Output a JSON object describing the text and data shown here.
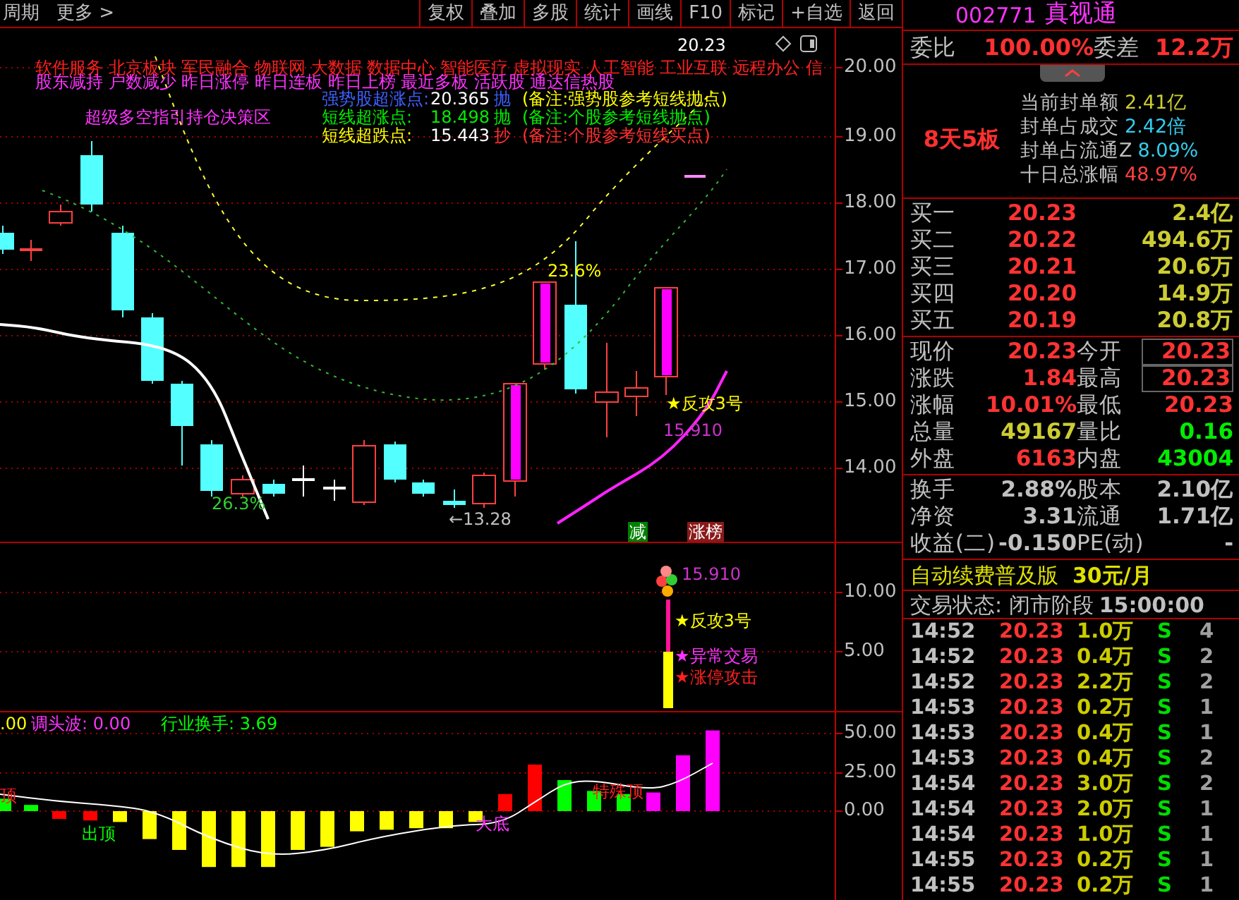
{
  "toolbar": {
    "period_label": "周期",
    "more_label": "更多 >",
    "buttons": [
      "复权",
      "叠加",
      "多股",
      "统计",
      "画线",
      "F10",
      "标记",
      "+自选",
      "返回"
    ]
  },
  "main_chart": {
    "concept_tags": "软件服务 北京板块 军民融合 物联网 大数据 数据中心 智能医疗 虚拟现实 人工智能 工业互联 远程办公 信",
    "signal_tags": "股东减持 户数减少 昨日涨停 昨日连板 昨日上榜 最近多板 活跃股 通达信热股",
    "overlay_price": "20.23",
    "title": "超级多空指引持仓决策区",
    "alerts": [
      {
        "kind": "strong",
        "label": "强势股超涨点:",
        "value": "20.365",
        "action": "抛",
        "note": "(备注:强势股参考短线抛点)"
      },
      {
        "kind": "sell",
        "label": "短线超涨点:",
        "value": "18.498",
        "action": "抛",
        "note": "(备注:个股参考短线抛点)"
      },
      {
        "kind": "buy",
        "label": "短线超跌点:",
        "value": "15.443",
        "action": "抄",
        "note": "(备注:个股参考短线买点)"
      }
    ],
    "annotations": [
      {
        "text": "23.6%",
        "color": "#ffff00"
      },
      {
        "text": "26.3%",
        "color": "#33cc33"
      },
      {
        "text": "←13.28",
        "color": "#c0c0c0"
      },
      {
        "text": "★反攻3号",
        "color": "#ffff00"
      },
      {
        "text": "15.910",
        "color": "#cc33cc"
      }
    ],
    "badges": [
      {
        "text": "减",
        "color": "#008000"
      },
      {
        "text": "涨榜",
        "color": "#8b1a1a"
      }
    ],
    "axis_labels": [
      "20.00",
      "19.00",
      "18.00",
      "17.00",
      "16.00",
      "15.00",
      "14.00"
    ]
  },
  "signal_chart": {
    "annotations": [
      {
        "text": "15.910",
        "color": "#cc33cc"
      },
      {
        "text": "★反攻3号",
        "color": "#ffff00"
      },
      {
        "text": "★异常交易",
        "color": "#ff33ff"
      },
      {
        "text": "★涨停攻击",
        "color": "#ff2020"
      }
    ],
    "axis_labels": [
      "10.00",
      "5.00"
    ]
  },
  "wave_chart": {
    "legend": [
      {
        "text": ".00",
        "color": "#ffff00"
      },
      {
        "text": "调头波: 0.00",
        "color": "#ff33ff"
      },
      {
        "text": "行业换手: 3.69",
        "color": "#00ff00"
      }
    ],
    "annotations": [
      {
        "text": "顶",
        "color": "#ff2020"
      },
      {
        "text": "出顶",
        "color": "#00ff00"
      },
      {
        "text": "大底",
        "color": "#ff33ff"
      },
      {
        "text": "特殊顶",
        "color": "#ff2020"
      }
    ],
    "axis_labels": [
      "50.00",
      "25.00",
      "0.00"
    ]
  },
  "quote_header": {
    "code": "002771",
    "name": "真视通"
  },
  "order_ratio": [
    {
      "label": "委比",
      "value": "100.00%"
    },
    {
      "label": "委差",
      "value": "12.2万"
    }
  ],
  "limit_info": {
    "streak": "8天5板",
    "rows": [
      {
        "label": "当前封单额",
        "value": "2.41亿",
        "color": "#cccc33"
      },
      {
        "label": "封单占成交",
        "value": "2.42倍",
        "color": "#33ccee"
      },
      {
        "label": "封单占流通Z",
        "value": "8.09%",
        "color": "#33ccee"
      },
      {
        "label": "十日总涨幅",
        "value": "48.97%",
        "color": "#ff4040"
      }
    ]
  },
  "bids": [
    {
      "label": "买一",
      "price": "20.23",
      "volume": "2.4亿"
    },
    {
      "label": "买二",
      "price": "20.22",
      "volume": "494.6万"
    },
    {
      "label": "买三",
      "price": "20.21",
      "volume": "20.6万"
    },
    {
      "label": "买四",
      "price": "20.20",
      "volume": "14.9万"
    },
    {
      "label": "买五",
      "price": "20.19",
      "volume": "20.8万"
    }
  ],
  "stats": [
    {
      "label": "现价",
      "value": "20.23",
      "color": "#ff3333",
      "boxed": false
    },
    {
      "label": "今开",
      "value": "20.23",
      "color": "#ff3333",
      "boxed": true
    },
    {
      "label": "涨跌",
      "value": "1.84",
      "color": "#ff3333",
      "boxed": false
    },
    {
      "label": "最高",
      "value": "20.23",
      "color": "#ff3333",
      "boxed": true
    },
    {
      "label": "涨幅",
      "value": "10.01%",
      "color": "#ff3333",
      "boxed": false
    },
    {
      "label": "最低",
      "value": "20.23",
      "color": "#ff3333",
      "boxed": false
    },
    {
      "label": "总量",
      "value": "49167",
      "color": "#cccc33",
      "boxed": false
    },
    {
      "label": "量比",
      "value": "0.16",
      "color": "#00ee00",
      "boxed": false
    },
    {
      "label": "外盘",
      "value": "6163",
      "color": "#ff3333",
      "boxed": false
    },
    {
      "label": "内盘",
      "value": "43004",
      "color": "#00ee00",
      "boxed": false
    }
  ],
  "fundamentals": [
    {
      "label": "换手",
      "value": "2.88%"
    },
    {
      "label": "股本",
      "value": "2.10亿"
    },
    {
      "label": "净资",
      "value": "3.31"
    },
    {
      "label": "流通",
      "value": "1.71亿"
    },
    {
      "label": "收益(二)",
      "value": "-0.150"
    },
    {
      "label": "PE(动)",
      "value": "-"
    }
  ],
  "promo": {
    "text": "自动续费普及版",
    "price": "30元/月"
  },
  "trade_status": {
    "label": "交易状态: 闭市阶段",
    "time": "15:00:00"
  },
  "trades": [
    {
      "time": "14:52",
      "price": "20.23",
      "volume": "1.0万",
      "side": "S",
      "count": "4"
    },
    {
      "time": "14:52",
      "price": "20.23",
      "volume": "0.4万",
      "side": "S",
      "count": "2"
    },
    {
      "time": "14:52",
      "price": "20.23",
      "volume": "2.2万",
      "side": "S",
      "count": "2"
    },
    {
      "time": "14:53",
      "price": "20.23",
      "volume": "0.2万",
      "side": "S",
      "count": "1"
    },
    {
      "time": "14:53",
      "price": "20.23",
      "volume": "0.4万",
      "side": "S",
      "count": "1"
    },
    {
      "time": "14:53",
      "price": "20.23",
      "volume": "0.4万",
      "side": "S",
      "count": "2"
    },
    {
      "time": "14:54",
      "price": "20.23",
      "volume": "3.0万",
      "side": "S",
      "count": "2"
    },
    {
      "time": "14:54",
      "price": "20.23",
      "volume": "2.0万",
      "side": "S",
      "count": "1"
    },
    {
      "time": "14:54",
      "price": "20.23",
      "volume": "1.0万",
      "side": "S",
      "count": "1"
    },
    {
      "time": "14:55",
      "price": "20.23",
      "volume": "0.2万",
      "side": "S",
      "count": "1"
    },
    {
      "time": "14:55",
      "price": "20.23",
      "volume": "0.2万",
      "side": "S",
      "count": "1"
    }
  ]
}
